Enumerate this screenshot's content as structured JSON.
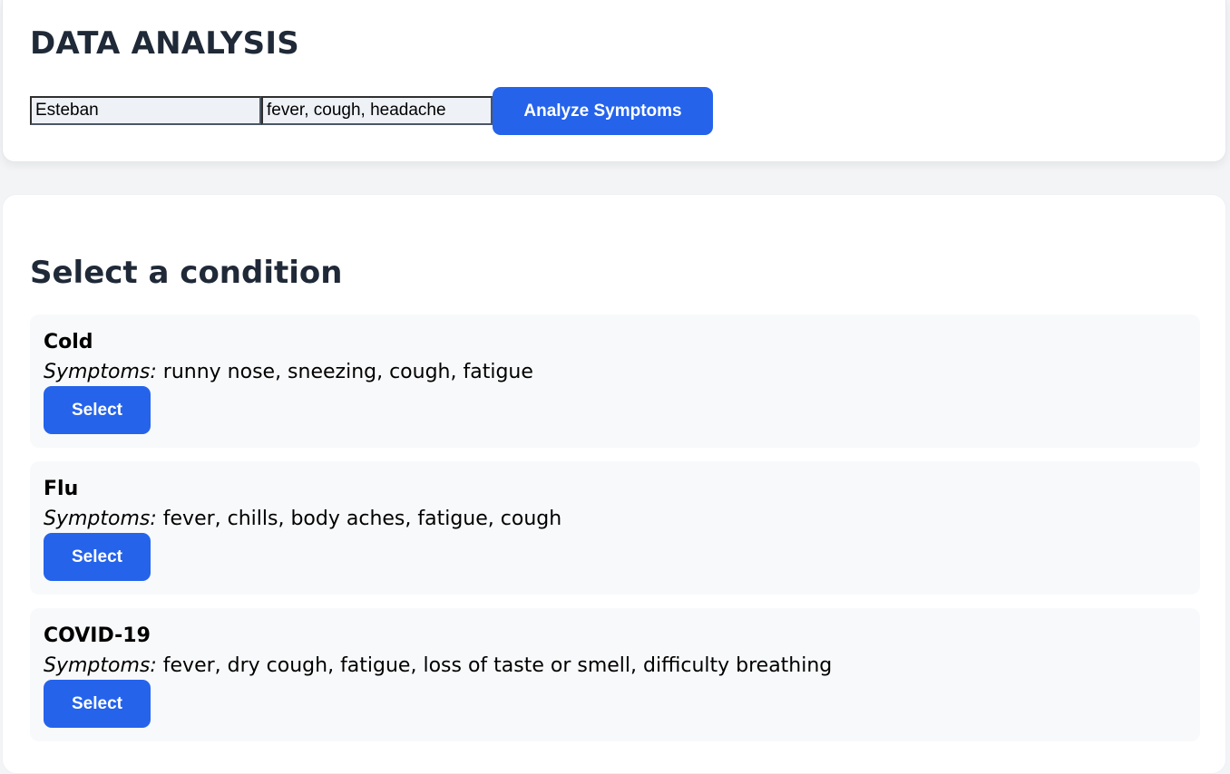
{
  "header": {
    "title": "DATA ANALYSIS",
    "name_value": "Esteban",
    "symptoms_value": "fever, cough, headache",
    "analyze_label": "Analyze Symptoms"
  },
  "main": {
    "title": "Select a condition",
    "symptoms_prefix": "Symptoms:",
    "conditions": [
      {
        "name": "Cold",
        "symptoms": "runny nose, sneezing, cough, fatigue",
        "button": "Select"
      },
      {
        "name": "Flu",
        "symptoms": "fever, chills, body aches, fatigue, cough",
        "button": "Select"
      },
      {
        "name": "COVID-19",
        "symptoms": "fever, dry cough, fatigue, loss of taste or smell, difficulty breathing",
        "button": "Select"
      }
    ]
  },
  "colors": {
    "accent": "#2563eb",
    "background": "#f3f4f6",
    "card": "#ffffff",
    "condition_bg": "#f8f9fa",
    "heading": "#1f2937"
  }
}
